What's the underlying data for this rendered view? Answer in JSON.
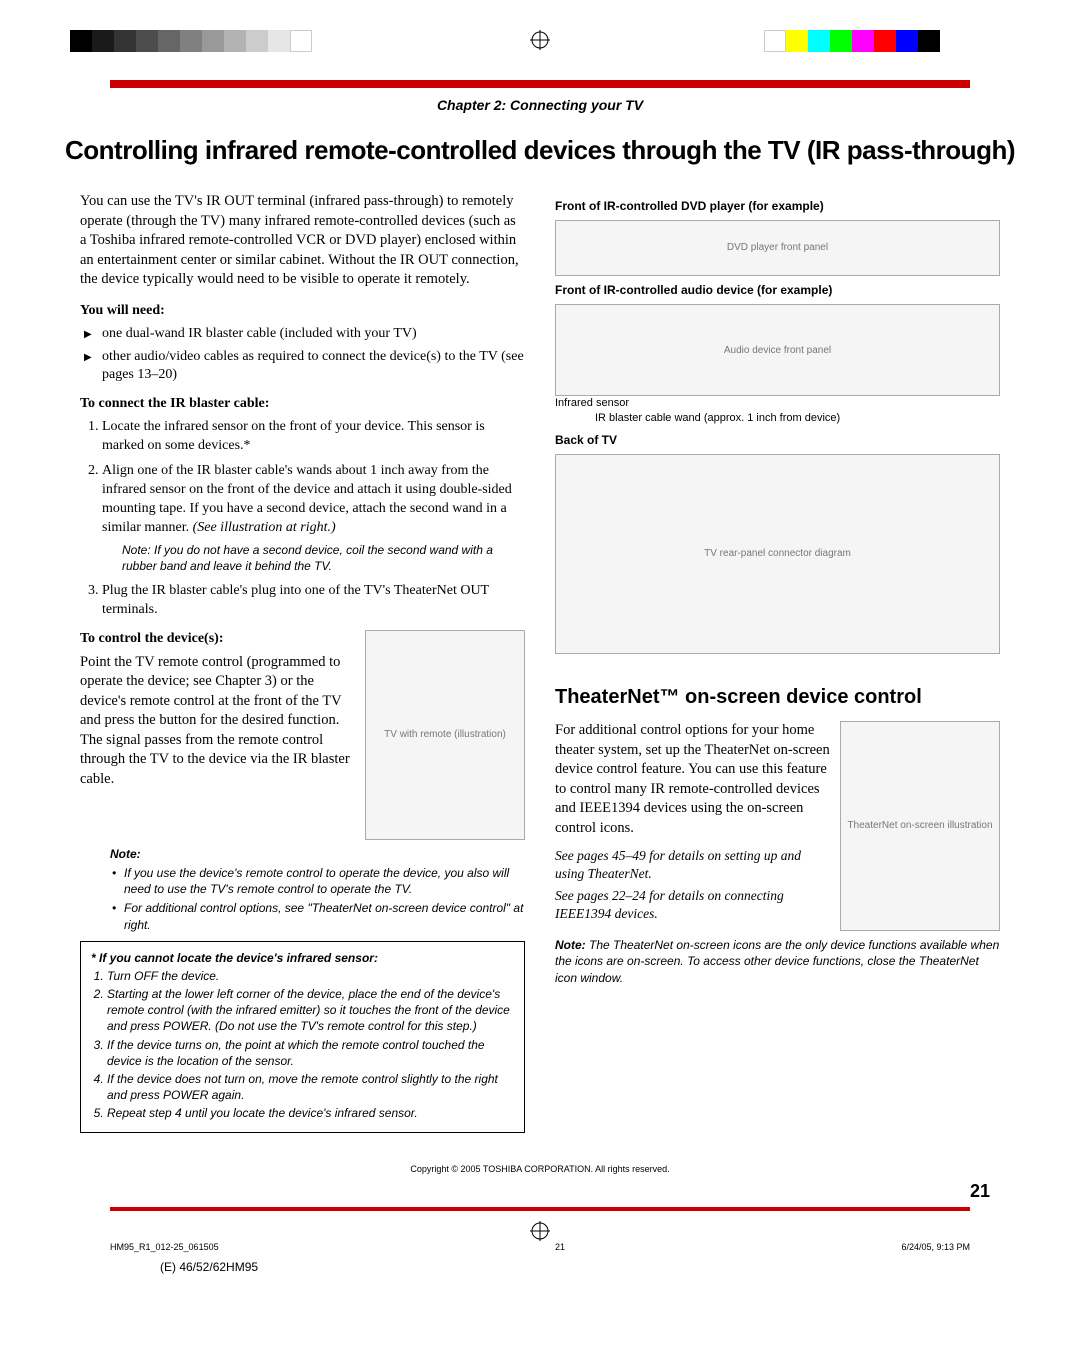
{
  "chapter": "Chapter 2: Connecting your TV",
  "title": "Controlling infrared remote-controlled devices through the TV (IR pass-through)",
  "intro": "You can use the TV's IR OUT terminal (infrared pass-through) to remotely operate (through the TV) many infrared remote-controlled devices (such as a Toshiba infrared remote-controlled VCR or DVD player) enclosed within an entertainment center or similar cabinet. Without the IR OUT connection, the device typically would need to be visible to operate it remotely.",
  "need_head": "You will need:",
  "need": [
    "one dual-wand IR blaster cable (included with your TV)",
    "other audio/video cables as required to connect the device(s) to the TV (see pages 13–20)"
  ],
  "connect_head": "To connect the IR blaster cable:",
  "connect": [
    "Locate the infrared sensor on the front of your device. This sensor is marked on some devices.*",
    "Align one of the IR blaster cable's wands about 1 inch away from the infrared sensor on the front of the device and attach it using double-sided mounting tape. If you have a second device, attach the second wand in a similar manner.",
    "Plug the IR blaster cable's plug into one of the TV's TheaterNet OUT terminals."
  ],
  "illref": "(See illustration at right.)",
  "note_coil": "Note: If you do not have a second device, coil the second wand with a rubber band and leave it behind the TV.",
  "control_head": "To control the device(s):",
  "control_body": "Point the TV remote control (programmed to operate the device; see Chapter 3) or the device's remote control at the front of the TV and press the button for the desired function. The signal passes from the remote control through the TV to the device via the IR blaster cable.",
  "note2_label": "Note:",
  "note2_items": [
    "If you use the device's remote control to operate the device, you also will need to use the TV's remote control to operate the TV.",
    "For additional control options, see \"TheaterNet on-screen device control\" at right."
  ],
  "sensor_head": "* If you cannot locate the device's infrared sensor:",
  "sensor_steps": [
    "Turn OFF the device.",
    "Starting at the lower left corner of the device, place the end of the device's remote control (with the infrared emitter) so it touches the front of the device and press POWER. (Do not use the TV's remote control for this step.)",
    "If the device turns on, the point at which the remote control touched the device is the location of the sensor.",
    "If the device does not turn on, move the remote control slightly to the right and press POWER again.",
    "Repeat step 4 until you locate the device's infrared sensor."
  ],
  "rcol": {
    "dvd_label": "Front of IR-controlled DVD player (for example)",
    "audio_label": "Front of IR-controlled audio device (for example)",
    "ir_sensor": "Infrared sensor",
    "wand_caption": "IR blaster cable wand (approx. 1 inch from device)",
    "back_label": "Back of TV"
  },
  "tn_title": "TheaterNet™ on-screen device control",
  "tn_body": "For additional control options for your home theater system, set up the TheaterNet on-screen device control feature. You can use this feature to control many IR remote-controlled devices and IEEE1394 devices using the on-screen control icons.",
  "tn_see1": "See pages 45–49 for details on setting up and using TheaterNet.",
  "tn_see2": "See pages 22–24 for details on connecting IEEE1394 devices.",
  "tn_note": "Note: The TheaterNet on-screen icons are the only device functions available when the icons are on-screen. To access other device functions, close the TheaterNet icon window.",
  "copyright": "Copyright © 2005 TOSHIBA CORPORATION. All rights reserved.",
  "page_number": "21",
  "footer_left": "HM95_R1_012-25_061505",
  "footer_mid": "21",
  "footer_right": "6/24/05, 9:13 PM",
  "model": "(E) 46/52/62HM95",
  "graybar_colors": [
    "#000",
    "#1a1a1a",
    "#333",
    "#4d4d4d",
    "#666",
    "#808080",
    "#999",
    "#b3b3b3",
    "#ccc",
    "#e6e6e6",
    "#fff"
  ],
  "colorbar_colors": [
    "#fff",
    "#ff0",
    "#0ff",
    "#0f0",
    "#f0f",
    "#f00",
    "#00f",
    "#000"
  ]
}
